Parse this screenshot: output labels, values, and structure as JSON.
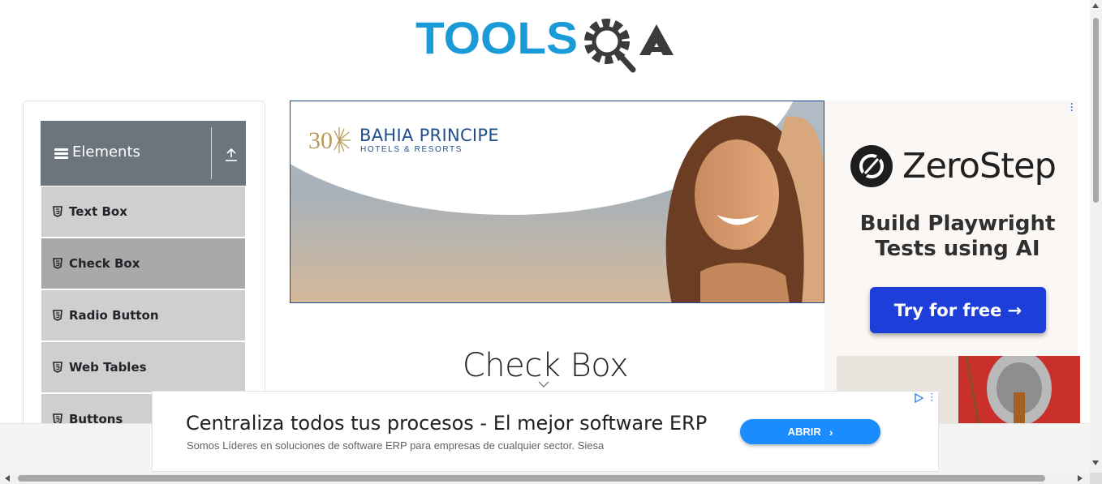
{
  "header": {
    "logo_text_primary": "TOOLS",
    "logo_text_secondary": "QA",
    "logo_icon": "gear-magnifier-icon",
    "colors": {
      "primary": "#1a9bd7",
      "secondary": "#3b3b3b"
    }
  },
  "sidebar": {
    "group_title": "Elements",
    "group_icon": "hamburger-icon",
    "collapse_icon": "upload-icon",
    "items": [
      {
        "label": "Text Box",
        "icon": "html5-icon",
        "active": false
      },
      {
        "label": "Check Box",
        "icon": "html5-icon",
        "active": true
      },
      {
        "label": "Radio Button",
        "icon": "html5-icon",
        "active": false
      },
      {
        "label": "Web Tables",
        "icon": "html5-icon",
        "active": false
      },
      {
        "label": "Buttons",
        "icon": "html5-icon",
        "active": false
      }
    ],
    "colors": {
      "header": "#6c757d",
      "item": "#cfcfcf",
      "item_active": "#a9a9a9"
    }
  },
  "banner_ad": {
    "brand": "BAHIA PRINCIPE",
    "subtitle": "HOTELS & RESORTS",
    "logo_mark": "30"
  },
  "right_ad": {
    "brand": "ZeroStep",
    "tagline": "Build Playwright Tests using AI",
    "cta": "Try for free →",
    "colors": {
      "cta": "#1d3ed8"
    }
  },
  "main": {
    "page_title": "Check Box"
  },
  "bottom_ad": {
    "headline": "Centraliza todos tus procesos - El mejor software ERP",
    "description": "Somos Líderes en soluciones de software ERP para empresas de cualquier sector. Siesa",
    "cta": "ABRIR",
    "colors": {
      "cta": "#1a8cff"
    }
  }
}
